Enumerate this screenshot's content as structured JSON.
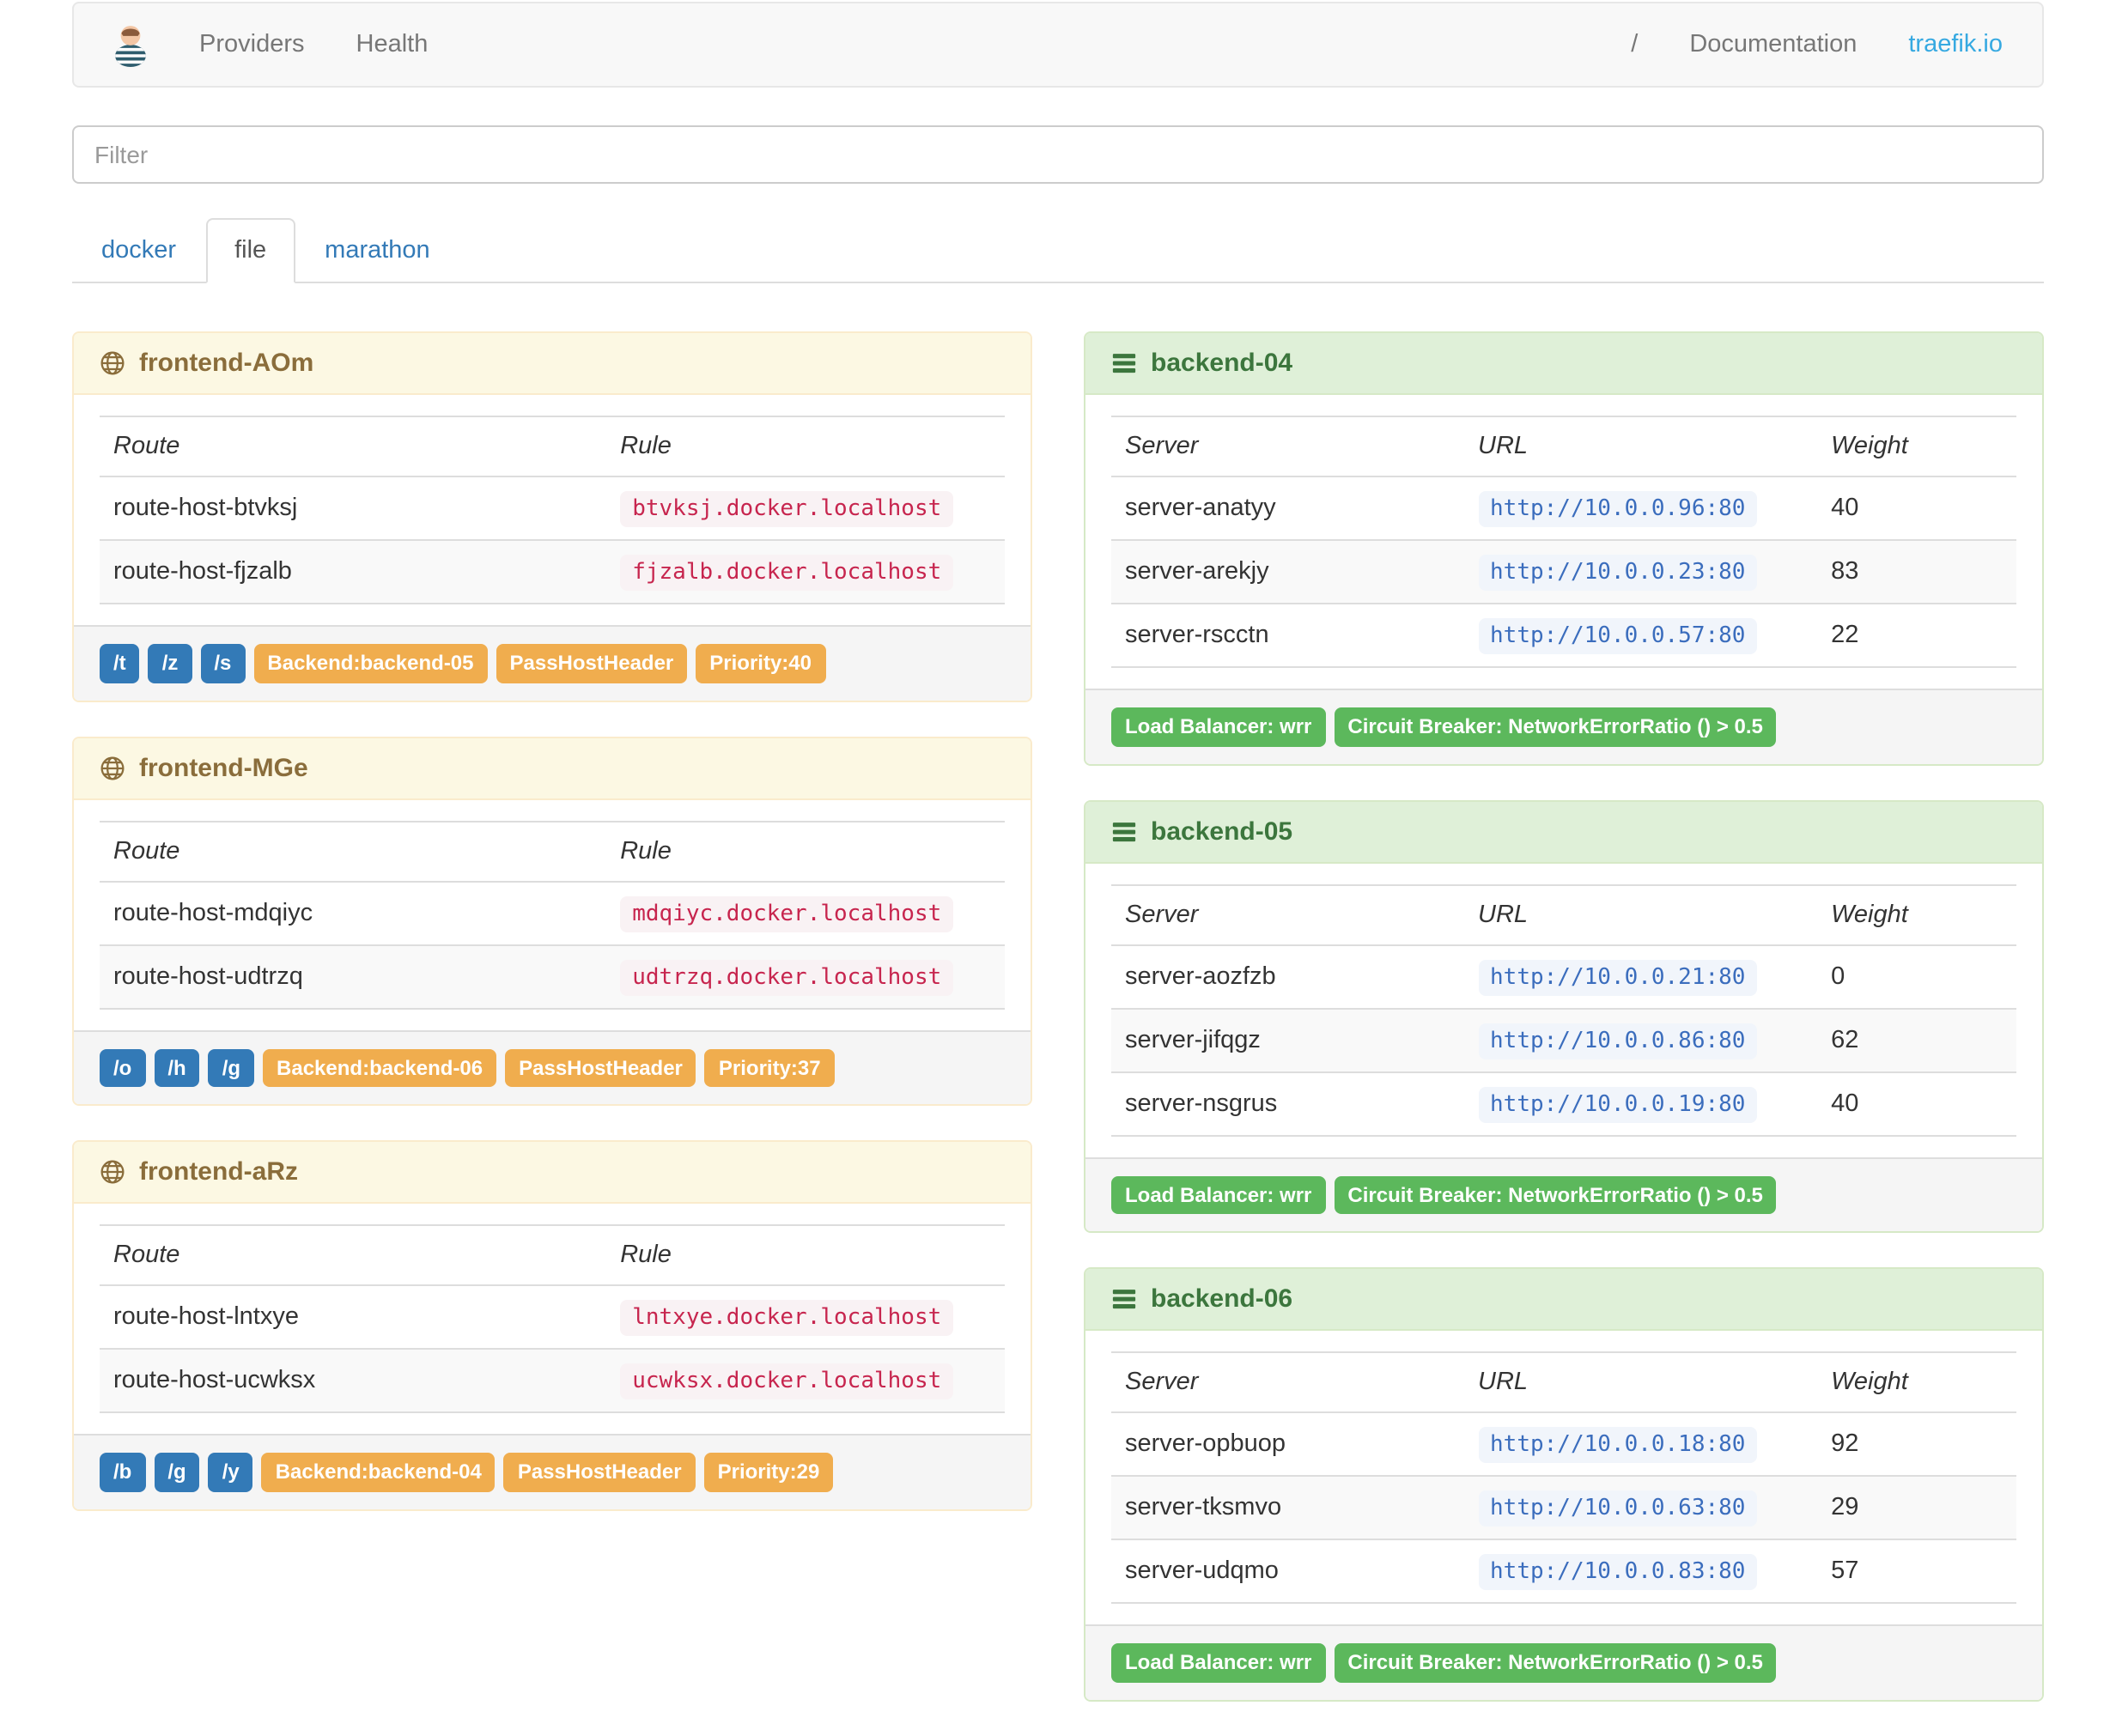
{
  "navbar": {
    "brand_icon": "traefik-logo",
    "items": [
      {
        "label": "Providers"
      },
      {
        "label": "Health"
      }
    ],
    "right": {
      "separator": "/",
      "documentation": "Documentation",
      "site": "traefik.io"
    }
  },
  "filter": {
    "placeholder": "Filter"
  },
  "tabs": [
    {
      "label": "docker",
      "active": false
    },
    {
      "label": "file",
      "active": true
    },
    {
      "label": "marathon",
      "active": false
    }
  ],
  "frontend_columns": [
    "Route",
    "Rule"
  ],
  "backend_columns": [
    "Server",
    "URL",
    "Weight"
  ],
  "frontends": [
    {
      "title": "frontend-AOm",
      "routes": [
        {
          "route": "route-host-btvksj",
          "rule": "btvksj.docker.localhost"
        },
        {
          "route": "route-host-fjzalb",
          "rule": "fjzalb.docker.localhost"
        }
      ],
      "entry_badges": [
        "/t",
        "/z",
        "/s"
      ],
      "badges": [
        "Backend:backend-05",
        "PassHostHeader",
        "Priority:40"
      ]
    },
    {
      "title": "frontend-MGe",
      "routes": [
        {
          "route": "route-host-mdqiyc",
          "rule": "mdqiyc.docker.localhost"
        },
        {
          "route": "route-host-udtrzq",
          "rule": "udtrzq.docker.localhost"
        }
      ],
      "entry_badges": [
        "/o",
        "/h",
        "/g"
      ],
      "badges": [
        "Backend:backend-06",
        "PassHostHeader",
        "Priority:37"
      ]
    },
    {
      "title": "frontend-aRz",
      "routes": [
        {
          "route": "route-host-lntxye",
          "rule": "lntxye.docker.localhost"
        },
        {
          "route": "route-host-ucwksx",
          "rule": "ucwksx.docker.localhost"
        }
      ],
      "entry_badges": [
        "/b",
        "/g",
        "/y"
      ],
      "badges": [
        "Backend:backend-04",
        "PassHostHeader",
        "Priority:29"
      ]
    }
  ],
  "backends": [
    {
      "title": "backend-04",
      "servers": [
        {
          "server": "server-anatyy",
          "url": "http://10.0.0.96:80",
          "weight": "40"
        },
        {
          "server": "server-arekjy",
          "url": "http://10.0.0.23:80",
          "weight": "83"
        },
        {
          "server": "server-rscctn",
          "url": "http://10.0.0.57:80",
          "weight": "22"
        }
      ],
      "badges": [
        "Load Balancer: wrr",
        "Circuit Breaker: NetworkErrorRatio () > 0.5"
      ]
    },
    {
      "title": "backend-05",
      "servers": [
        {
          "server": "server-aozfzb",
          "url": "http://10.0.0.21:80",
          "weight": "0"
        },
        {
          "server": "server-jifqgz",
          "url": "http://10.0.0.86:80",
          "weight": "62"
        },
        {
          "server": "server-nsgrus",
          "url": "http://10.0.0.19:80",
          "weight": "40"
        }
      ],
      "badges": [
        "Load Balancer: wrr",
        "Circuit Breaker: NetworkErrorRatio () > 0.5"
      ]
    },
    {
      "title": "backend-06",
      "servers": [
        {
          "server": "server-opbuop",
          "url": "http://10.0.0.18:80",
          "weight": "92"
        },
        {
          "server": "server-tksmvo",
          "url": "http://10.0.0.63:80",
          "weight": "29"
        },
        {
          "server": "server-udqmo",
          "url": "http://10.0.0.83:80",
          "weight": "57"
        }
      ],
      "badges": [
        "Load Balancer: wrr",
        "Circuit Breaker: NetworkErrorRatio () > 0.5"
      ]
    }
  ],
  "colors": {
    "link_blue": "#337ab7",
    "accent_link": "#36a9e1",
    "navbar_bg": "#f8f8f8",
    "navbar_border": "#e7e7e7",
    "nav_text": "#777777",
    "warning_bg": "#fcf8e3",
    "warning_border": "#faebcc",
    "warning_text": "#8a6d3b",
    "success_bg": "#dff0d8",
    "success_border": "#d6e9c6",
    "success_text": "#3c763d",
    "footer_bg": "#f5f5f5",
    "table_border": "#dddddd",
    "stripe_bg": "#f9f9f9",
    "badge_blue": "#337ab7",
    "badge_orange": "#f0ad4e",
    "badge_green": "#5cb85c",
    "code_pink": "#c7254e",
    "code_pink_bg": "#f9f2f4",
    "code_blue": "#3b6dbd",
    "code_blue_bg": "#f1f5fb"
  }
}
